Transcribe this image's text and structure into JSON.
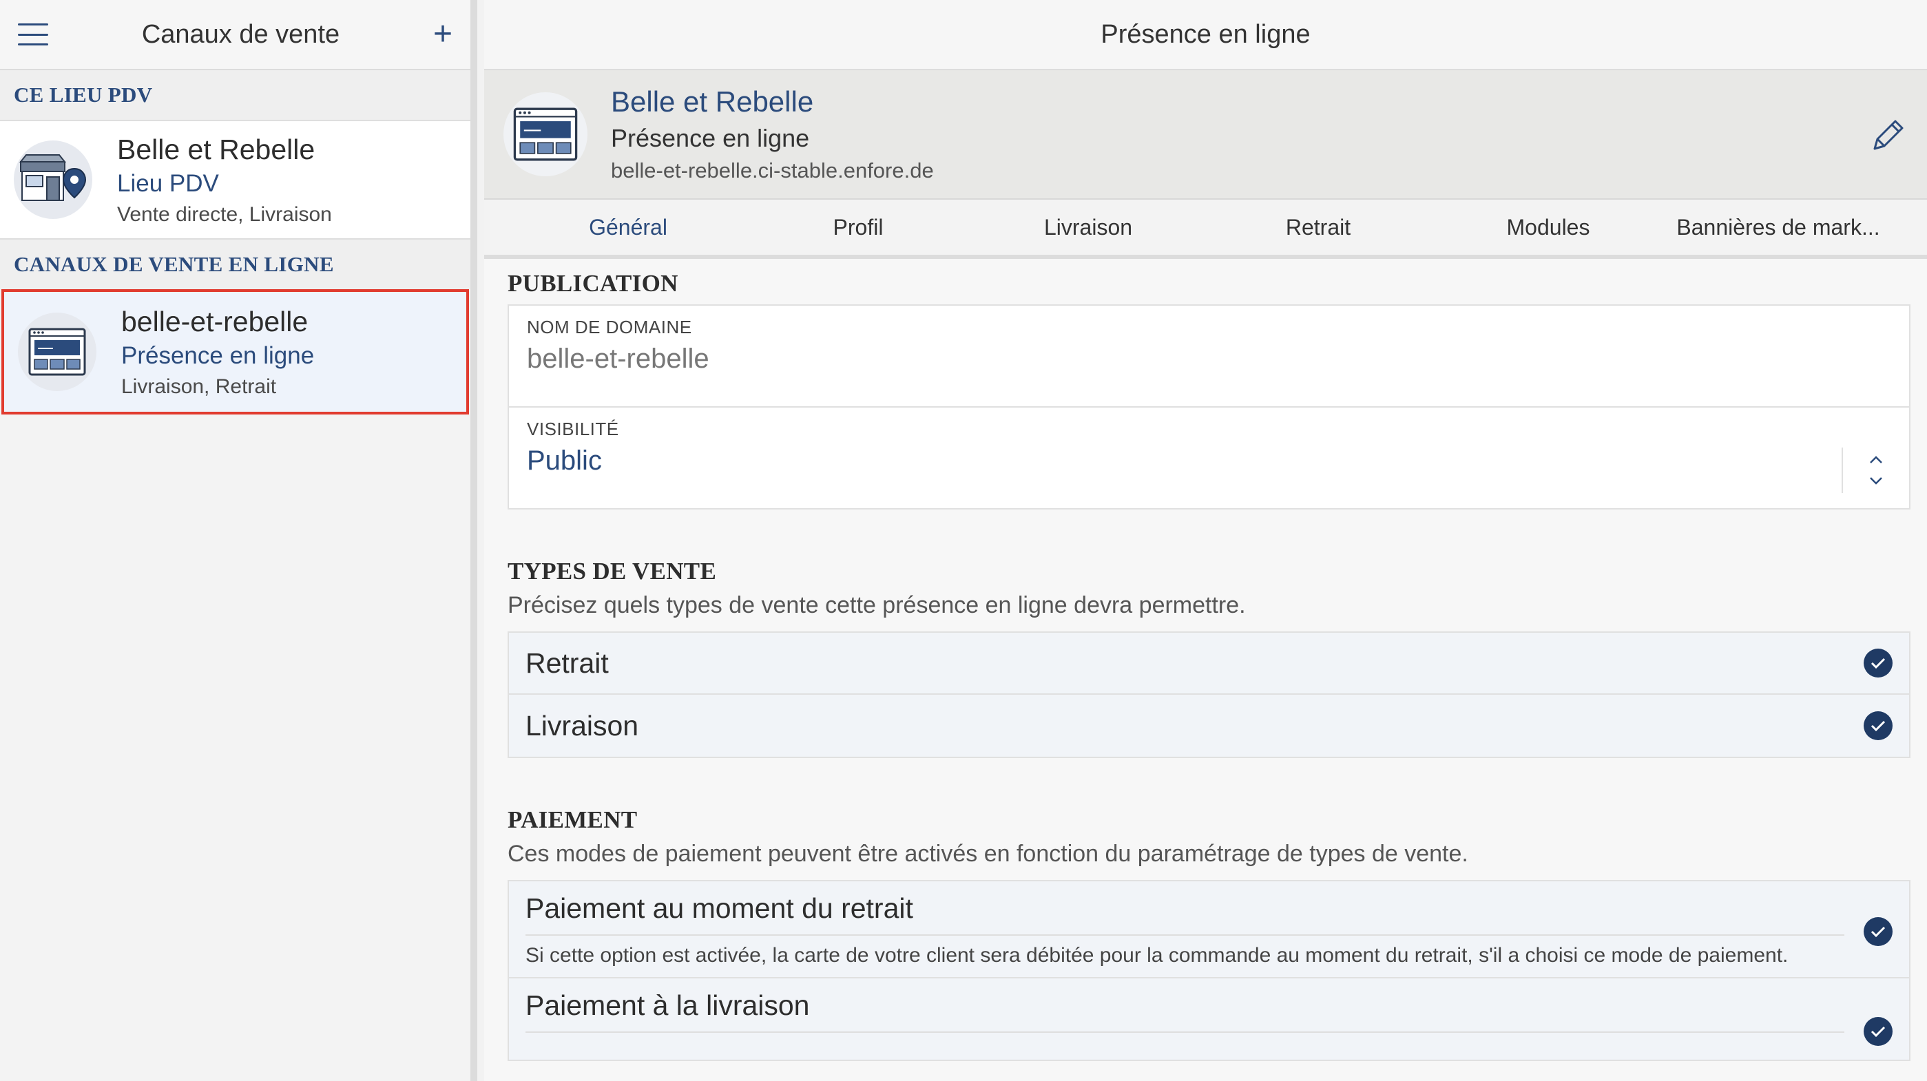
{
  "sidebar": {
    "title": "Canaux de vente",
    "section_pos": "CE LIEU PDV",
    "pos_item": {
      "name": "Belle et Rebelle",
      "type": "Lieu PDV",
      "desc": "Vente directe, Livraison"
    },
    "section_online": "CANAUX DE VENTE EN LIGNE",
    "online_item": {
      "name": "belle-et-rebelle",
      "type": "Présence en ligne",
      "desc": "Livraison, Retrait"
    }
  },
  "main": {
    "header_title": "Présence en ligne",
    "entity": {
      "name": "Belle et Rebelle",
      "type": "Présence en ligne",
      "url": "belle-et-rebelle.ci-stable.enfore.de"
    },
    "tabs": [
      "Général",
      "Profil",
      "Livraison",
      "Retrait",
      "Modules",
      "Bannières de mark..."
    ],
    "active_tab": "Général",
    "publication": {
      "title": "PUBLICATION",
      "domain_label": "NOM DE DOMAINE",
      "domain_value": "belle-et-rebelle",
      "visibility_label": "VISIBILITÉ",
      "visibility_value": "Public"
    },
    "sale_types": {
      "title": "TYPES DE VENTE",
      "subtitle": "Précisez quels types de vente cette présence en ligne devra permettre.",
      "items": [
        {
          "label": "Retrait",
          "checked": true
        },
        {
          "label": "Livraison",
          "checked": true
        }
      ]
    },
    "payment": {
      "title": "PAIEMENT",
      "subtitle": "Ces modes de paiement peuvent être activés en fonction du paramétrage de types de vente.",
      "items": [
        {
          "label": "Paiement au moment du retrait",
          "desc": "Si cette option est activée, la carte de votre client sera débitée pour la commande au moment du retrait, s'il a choisi ce mode de paiement.",
          "checked": true
        },
        {
          "label": "Paiement à la livraison",
          "checked": true
        }
      ]
    }
  },
  "colors": {
    "accent": "#2b4b7c",
    "selected_border": "#e13b2f",
    "check": "#1f3a64"
  }
}
